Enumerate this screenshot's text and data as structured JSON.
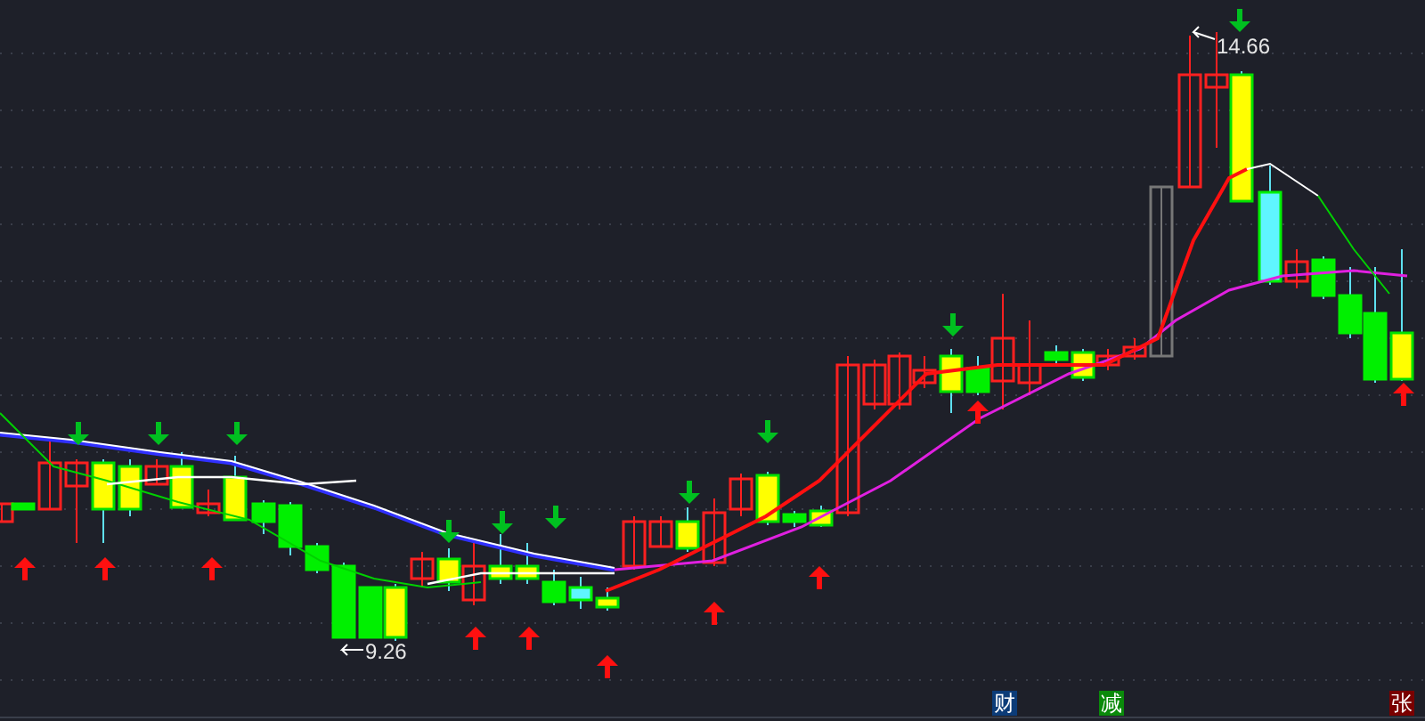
{
  "chart": {
    "high_label": "14.66",
    "low_label": "9.26"
  },
  "markers": [
    {
      "text": "财",
      "color": "#0c3c78"
    },
    {
      "text": "减",
      "color": "#0a8a0a"
    },
    {
      "text": "张",
      "color": "#7a0000"
    }
  ]
}
